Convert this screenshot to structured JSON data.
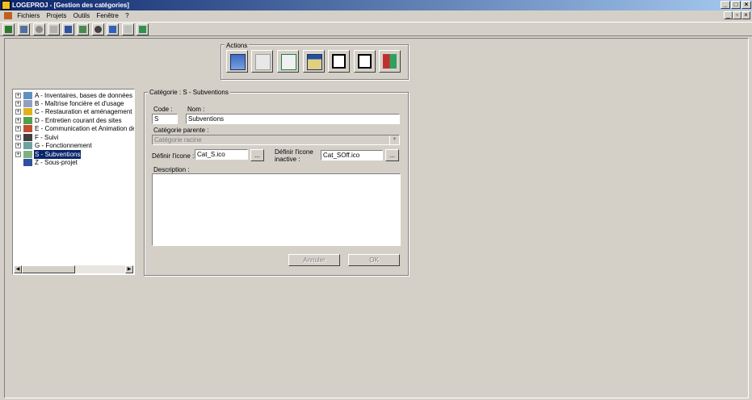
{
  "window": {
    "title": "LOGEPROJ - [Gestion des catégories]"
  },
  "menu": {
    "items": [
      "Fichiers",
      "Projets",
      "Outils",
      "Fenêtre",
      "?"
    ]
  },
  "actions": {
    "title": "Actions"
  },
  "tree": {
    "items": [
      {
        "label": "A - Inventaires, bases de données et do",
        "icon": "binoculars-icon"
      },
      {
        "label": "B - Maîtrise foncière et d'usage",
        "icon": "document-icon"
      },
      {
        "label": "C - Restauration et aménagement des si",
        "icon": "warning-icon"
      },
      {
        "label": "D - Entretien courant des sites",
        "icon": "landscape-icon"
      },
      {
        "label": "E - Communication et Animation de résea",
        "icon": "people-icon"
      },
      {
        "label": "F - Suivi",
        "icon": "binoculars-icon"
      },
      {
        "label": "G - Fonctionnement",
        "icon": "gear-icon"
      },
      {
        "label": "S - Subventions",
        "icon": "money-icon",
        "selected": true
      },
      {
        "label": "Z - Sous-projet",
        "icon": "folder-icon"
      }
    ]
  },
  "form": {
    "group_title": "Catégorie : S - Subventions",
    "code_label": "Code :",
    "code_value": "S",
    "nom_label": "Nom :",
    "nom_value": "Subventions",
    "parent_label": "Catégorie parente :",
    "parent_value": "Catégorie racine",
    "icon_label": "Définir l'icone :",
    "icon_value": "Cat_S.ico",
    "icon_inactive_label_1": "Définir l'icone",
    "icon_inactive_label_2": "inactive :",
    "icon_inactive_value": "Cat_SOff.ico",
    "browse_label": "...",
    "description_label": "Description :",
    "description_value": "",
    "cancel_label": "Annuler",
    "ok_label": "OK"
  },
  "colors": {
    "titlebar": "#0a246a",
    "selection": "#0a246a",
    "face": "#d4d0c8"
  }
}
